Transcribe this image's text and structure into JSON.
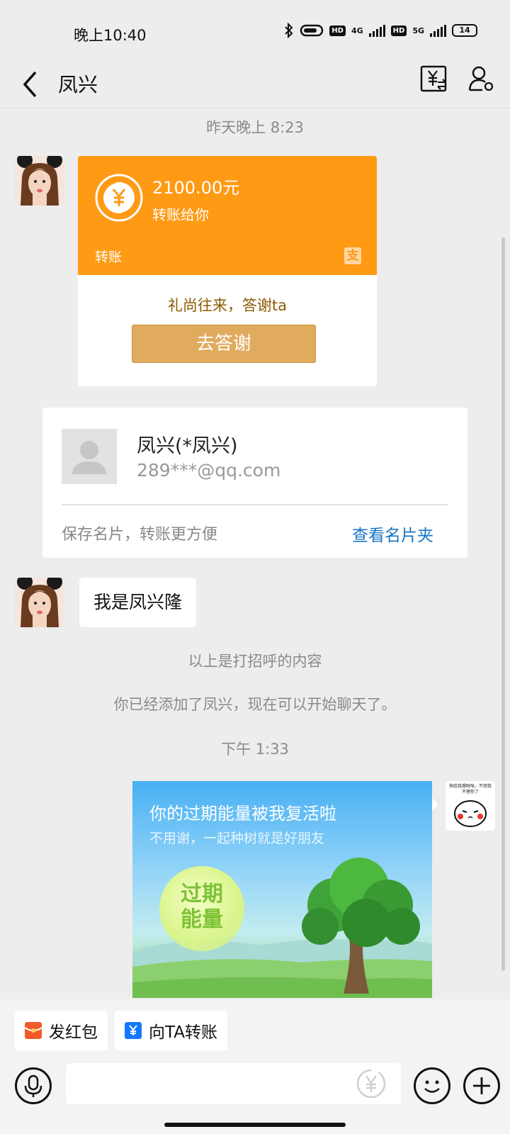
{
  "status_bar": {
    "time": "晚上10:40",
    "hd1": "HD",
    "net1": "4G",
    "hd2": "HD",
    "net2": "5G",
    "battery": "14"
  },
  "header": {
    "title": "凤兴"
  },
  "messages": {
    "timestamp_1": "昨天晚上 8:23",
    "transfer": {
      "amount": "2100.00元",
      "description": "转账给你",
      "label": "转账",
      "note": "礼尚往来，答谢ta",
      "button": "去答谢"
    },
    "contact_card": {
      "name": "凤兴(*凤兴)",
      "email": "289***@qq.com",
      "save_hint": "保存名片，转账更方便",
      "view_link": "查看名片夹"
    },
    "text_message": "我是凤兴隆",
    "system_1": "以上是打招呼的内容",
    "system_2": "你已经添加了凤兴，现在可以开始聊天了。",
    "timestamp_2": "下午 1:33",
    "energy_card": {
      "title": "你的过期能量被我复活啦",
      "subtitle": "不用谢，一起种树就是好朋友",
      "orb_line1": "过期",
      "orb_line2": "能量"
    },
    "sticker_text": "快给我撸呀咪，不然我不理你了"
  },
  "actions": {
    "red_packet": "发红包",
    "transfer_to": "向TA转账"
  },
  "input": {
    "placeholder": "",
    "value": ""
  },
  "colors": {
    "transfer_orange": "#fe9a14",
    "thanks_button": "#e0ab5c",
    "link_blue": "#1776c4",
    "background": "#ededed"
  }
}
